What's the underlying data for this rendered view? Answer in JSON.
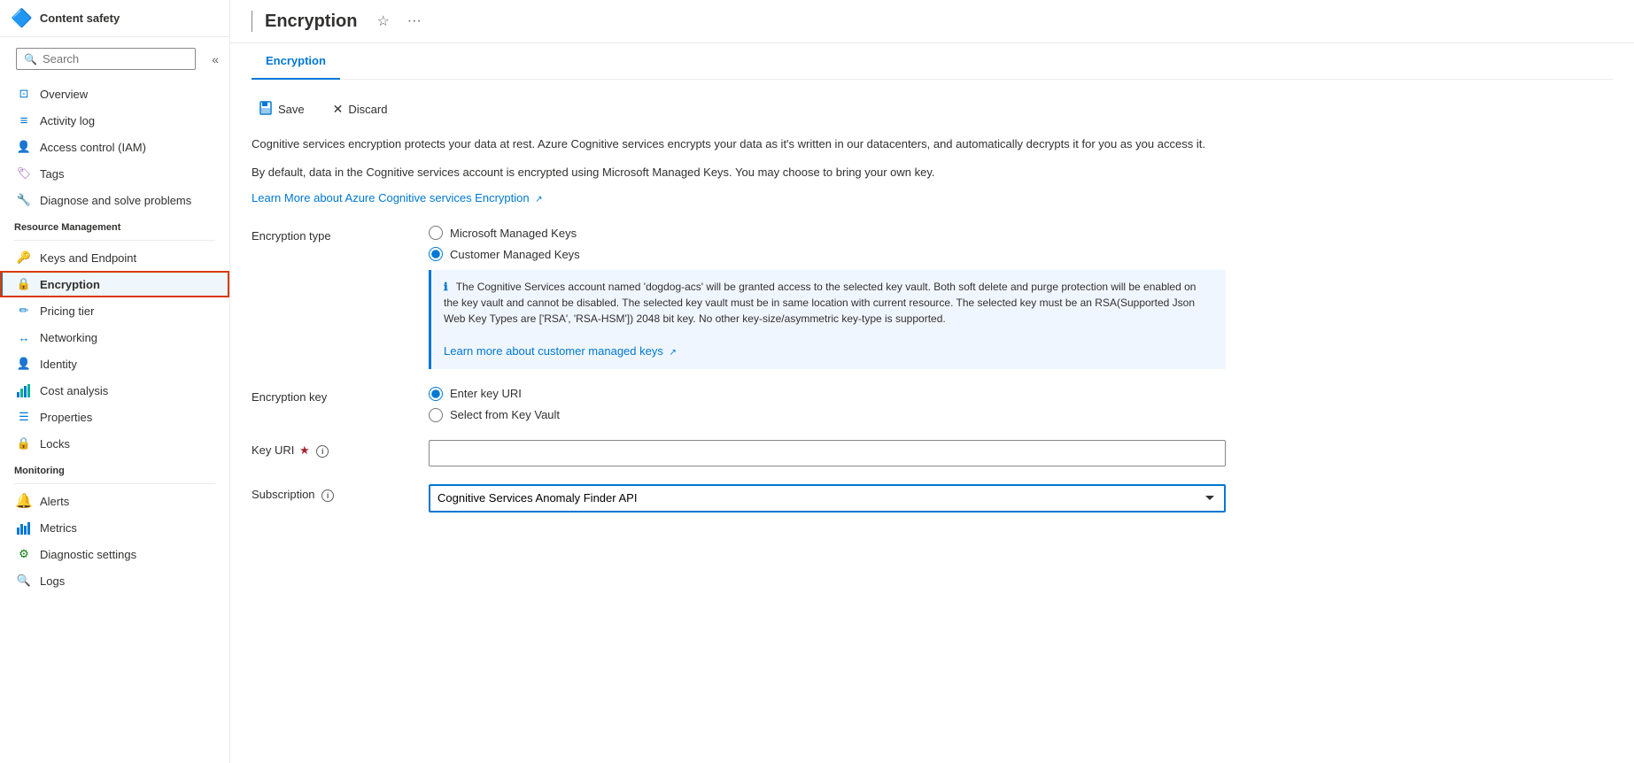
{
  "sidebar": {
    "service_icon": "🔷",
    "service_name": "Content safety",
    "search_placeholder": "Search",
    "collapse_label": "«",
    "nav_items": [
      {
        "id": "overview",
        "label": "Overview",
        "icon": "⊡",
        "icon_color": "#0078d4"
      },
      {
        "id": "activity-log",
        "label": "Activity log",
        "icon": "≡",
        "icon_color": "#0078d4"
      },
      {
        "id": "access-control",
        "label": "Access control (IAM)",
        "icon": "👤",
        "icon_color": "#0078d4"
      },
      {
        "id": "tags",
        "label": "Tags",
        "icon": "🏷",
        "icon_color": "#9b59b6"
      },
      {
        "id": "diagnose",
        "label": "Diagnose and solve problems",
        "icon": "🔧",
        "icon_color": "#605e5c"
      }
    ],
    "resource_management_label": "Resource Management",
    "resource_items": [
      {
        "id": "keys-endpoint",
        "label": "Keys and Endpoint",
        "icon": "🔑",
        "icon_color": "#f0a30a"
      },
      {
        "id": "encryption",
        "label": "Encryption",
        "icon": "🔒",
        "icon_color": "#d83b01",
        "active": true
      },
      {
        "id": "pricing-tier",
        "label": "Pricing tier",
        "icon": "✏",
        "icon_color": "#0078d4"
      },
      {
        "id": "networking",
        "label": "Networking",
        "icon": "↔",
        "icon_color": "#0078d4"
      },
      {
        "id": "identity",
        "label": "Identity",
        "icon": "👤",
        "icon_color": "#0078d4"
      },
      {
        "id": "cost-analysis",
        "label": "Cost analysis",
        "icon": "📊",
        "icon_color": "#0078d4"
      },
      {
        "id": "properties",
        "label": "Properties",
        "icon": "☰",
        "icon_color": "#0078d4"
      },
      {
        "id": "locks",
        "label": "Locks",
        "icon": "🔒",
        "icon_color": "#0078d4"
      }
    ],
    "monitoring_label": "Monitoring",
    "monitoring_items": [
      {
        "id": "alerts",
        "label": "Alerts",
        "icon": "🔔",
        "icon_color": "#0078d4"
      },
      {
        "id": "metrics",
        "label": "Metrics",
        "icon": "📈",
        "icon_color": "#0078d4"
      },
      {
        "id": "diagnostic-settings",
        "label": "Diagnostic settings",
        "icon": "⚙",
        "icon_color": "#0078d4"
      },
      {
        "id": "logs",
        "label": "Logs",
        "icon": "🔍",
        "icon_color": "#0078d4"
      }
    ]
  },
  "page": {
    "title": "Encryption",
    "tab_label": "Encryption",
    "save_label": "Save",
    "discard_label": "Discard",
    "description1": "Cognitive services encryption protects your data at rest. Azure Cognitive services encrypts your data as it's written in our datacenters, and automatically decrypts it for you as you access it.",
    "description2": "By default, data in the Cognitive services account is encrypted using Microsoft Managed Keys. You may choose to bring your own key.",
    "learn_more_link": "Learn More about Azure Cognitive services Encryption",
    "encryption_type_label": "Encryption type",
    "radio_microsoft": "Microsoft Managed Keys",
    "radio_customer": "Customer Managed Keys",
    "info_text": "The Cognitive Services account named 'dogdog-acs' will be granted access to the selected key vault. Both soft delete and purge protection will be enabled on the key vault and cannot be disabled. The selected key vault must be in same location with current resource. The selected key must be an RSA(Supported Json Web Key Types are ['RSA', 'RSA-HSM']) 2048 bit key. No other key-size/asymmetric key-type is supported.",
    "learn_more_cmk": "Learn more about customer managed keys",
    "encryption_key_label": "Encryption key",
    "radio_enter_uri": "Enter key URI",
    "radio_select_vault": "Select from Key Vault",
    "key_uri_label": "Key URI",
    "key_uri_required": "★",
    "subscription_label": "Subscription",
    "subscription_value": "Cognitive Services Anomaly Finder API",
    "subscription_options": [
      "Cognitive Services Anomaly Finder API"
    ]
  }
}
